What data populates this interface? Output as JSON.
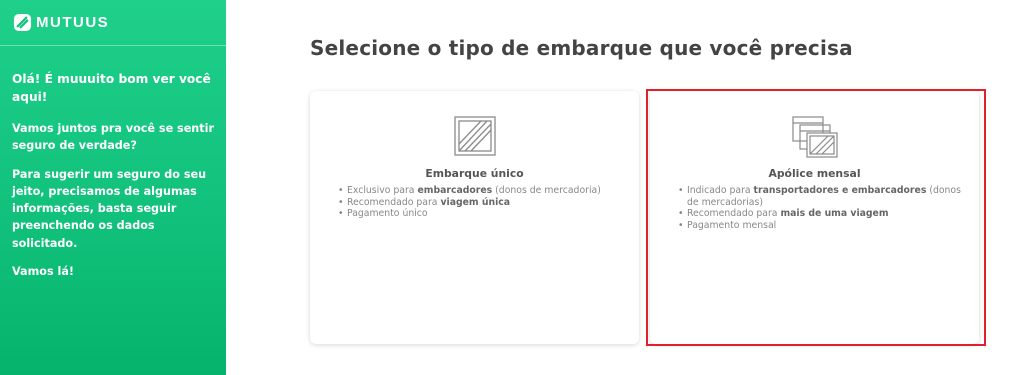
{
  "brand": {
    "name": "mutuus",
    "icon": "mutuus-logo-icon"
  },
  "sidebar": {
    "greeting": "Olá! É muuuito bom ver você aqui!",
    "paragraph1": "Vamos juntos pra você se sentir seguro de verdade?",
    "paragraph2": "Para sugerir um seguro do seu jeito, precisamos de algumas informações, basta seguir preenchendo os dados solicitado.",
    "paragraph3": "Vamos lá!"
  },
  "main": {
    "title": "Selecione o tipo de embarque que você precisa",
    "cards": [
      {
        "icon": "single-crate-icon",
        "title": "Embarque único",
        "bullets": [
          {
            "pre": "Exclusivo para ",
            "bold": "embarcadores",
            "post": " (donos de mercadoria)"
          },
          {
            "pre": "Recomendado para ",
            "bold": "viagem única",
            "post": ""
          },
          {
            "pre": "Pagamento único",
            "bold": "",
            "post": ""
          }
        ]
      },
      {
        "icon": "stacked-crates-icon",
        "title": "Apólice mensal",
        "bullets": [
          {
            "pre": "Indicado para ",
            "bold": "transportadores e embarcadores",
            "post": " (donos de mercadorias)"
          },
          {
            "pre": "Recomendado para ",
            "bold": "mais de uma viagem",
            "post": ""
          },
          {
            "pre": "Pagamento mensal",
            "bold": "",
            "post": ""
          }
        ]
      }
    ]
  },
  "colors": {
    "sidebar_top": "#1fd08a",
    "sidebar_bottom": "#06b36c",
    "selection_outline": "#e0202a",
    "icon_gray": "#8a8a8a"
  }
}
